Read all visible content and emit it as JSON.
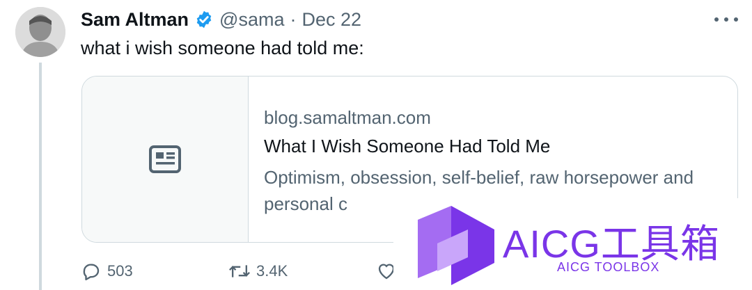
{
  "tweet": {
    "author_name": "Sam Altman",
    "handle": "@sama",
    "separator": "·",
    "date": "Dec 22",
    "text": "what i wish someone had told me:"
  },
  "card": {
    "domain": "blog.samaltman.com",
    "title": "What I Wish Someone Had Told Me",
    "description": "Optimism, obsession, self-belief, raw horsepower and personal c"
  },
  "actions": {
    "replies": "503",
    "retweets": "3.4K"
  },
  "watermark": {
    "title": "AICG工具箱",
    "subtitle": "AICG TOOLBOX",
    "color": "#7a35e8"
  },
  "icons": {
    "verified": "verified-badge-icon",
    "more": "more-icon",
    "card_thumb": "article-icon",
    "reply": "reply-icon",
    "retweet": "retweet-icon",
    "like": "like-icon"
  },
  "colors": {
    "verified": "#1d9bf0",
    "secondary_text": "#536471",
    "border": "#cfd9de"
  }
}
